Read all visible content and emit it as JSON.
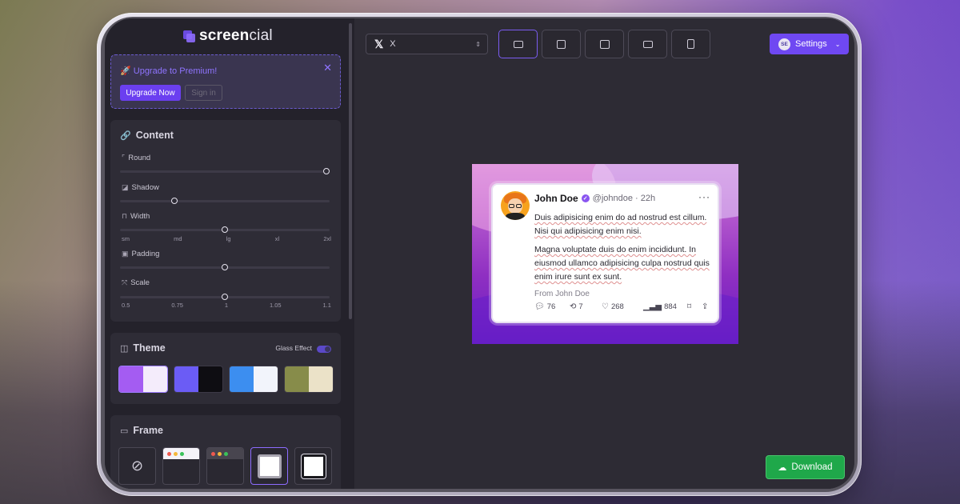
{
  "brand": {
    "name_bold": "screen",
    "name_rest": "cial"
  },
  "premium": {
    "icon": "rocket-icon",
    "title": "🚀 Upgrade to Premium!",
    "close": "✕",
    "upgrade_label": "Upgrade Now",
    "signin_label": "Sign in"
  },
  "content_panel": {
    "title": "Content",
    "sliders": [
      {
        "label": "Round",
        "value_fraction": 1.0
      },
      {
        "label": "Shadow",
        "value_fraction": 0.25
      },
      {
        "label": "Width",
        "value_fraction": 0.5,
        "ticks": [
          "sm",
          "md",
          "lg",
          "xl",
          "2xl"
        ]
      },
      {
        "label": "Padding",
        "value_fraction": 0.5
      },
      {
        "label": "Scale",
        "value_fraction": 0.5,
        "ticks": [
          "0.5",
          "0.75",
          "1",
          "1.05",
          "1.1"
        ]
      }
    ]
  },
  "theme_panel": {
    "title": "Theme",
    "glass_label": "Glass Effect",
    "glass_on": true,
    "swatches": [
      {
        "left": "#a45cf2",
        "right": "#f4ecfb",
        "selected": true
      },
      {
        "left": "#6b5cf5",
        "right": "#0e0d12",
        "selected": false
      },
      {
        "left": "#3c8ef0",
        "right": "#f2f4fb",
        "selected": false
      },
      {
        "left": "#878c4a",
        "right": "#ebe2c8",
        "selected": false
      }
    ]
  },
  "frame_panel": {
    "title": "Frame",
    "options": [
      "none",
      "light-window",
      "dark-window",
      "solid-border",
      "thick-border"
    ],
    "selected": "solid-border"
  },
  "toolbar": {
    "platform_label": "X",
    "platform_arrow": "⇕",
    "ratio_options": [
      "landscape",
      "square",
      "custom",
      "wide",
      "portrait"
    ],
    "selected_ratio": "landscape"
  },
  "settings": {
    "avatar_text": "SE",
    "label": "Settings",
    "chevron": "⌄"
  },
  "download": {
    "label": "Download"
  },
  "tweet": {
    "name": "John Doe",
    "verified_mark": "✓",
    "handle": "@johndoe · 22h",
    "more": "···",
    "paragraph1": "Duis adipisicing enim do ad nostrud est cillum. Nisi qui adipisicing enim nisi.",
    "paragraph2": "Magna voluptate duis do enim incididunt. In eiusmod ullamco adipisicing culpa nostrud quis enim irure sunt ex sunt.",
    "from": "From John Doe",
    "replies": "76",
    "retweets": "7",
    "likes": "268",
    "views": "884"
  }
}
